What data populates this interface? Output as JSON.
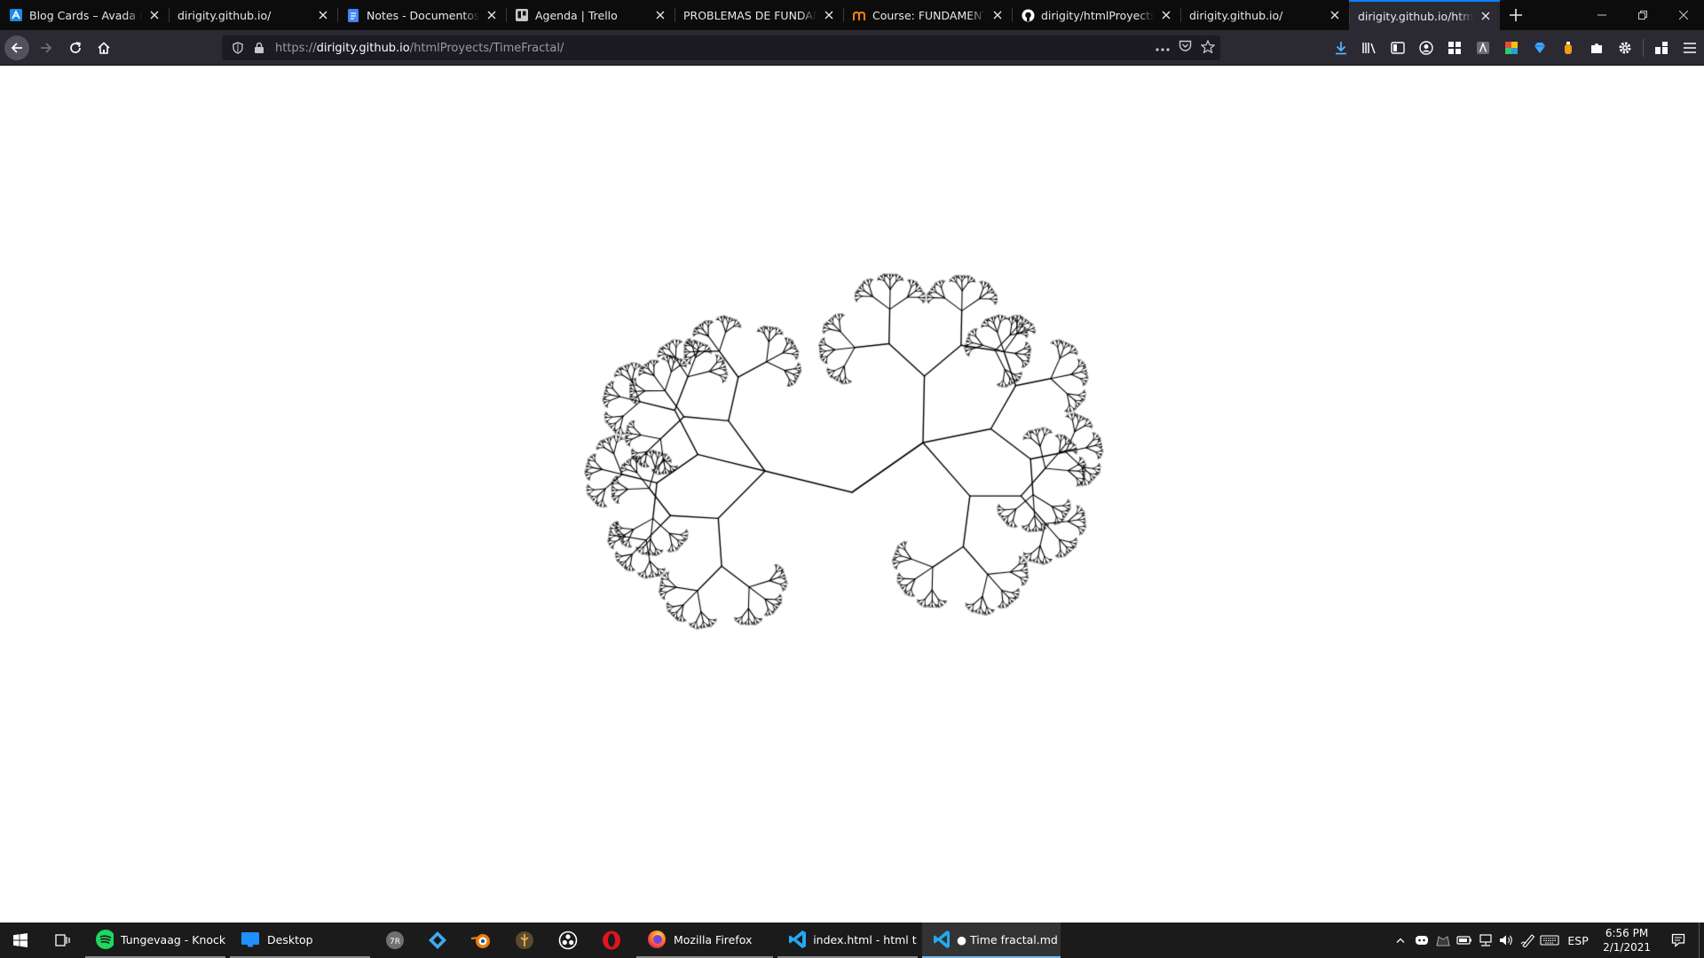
{
  "browser": {
    "tabs": [
      {
        "title": "Blog Cards – Avada Blog",
        "icon": "avada-icon",
        "color": "#1e88e5"
      },
      {
        "title": "dirigity.github.io/",
        "icon": "none"
      },
      {
        "title": "Notes - Documentos de Google",
        "icon": "google-docs-icon",
        "color": "#4285f4"
      },
      {
        "title": "Agenda | Trello",
        "icon": "trello-icon",
        "color": "#c7c7c7"
      },
      {
        "title": "PROBLEMAS DE FUNDAMENTOS",
        "icon": "none"
      },
      {
        "title": "Course: FUNDAMENTOS",
        "icon": "moodle-icon",
        "color": "#f98012"
      },
      {
        "title": "dirigity/htmlProyects",
        "icon": "github-icon",
        "color": "#ffffff"
      },
      {
        "title": "dirigity.github.io/",
        "icon": "none"
      },
      {
        "title": "dirigity.github.io/htmlProyects",
        "icon": "none",
        "active": true
      }
    ],
    "url": {
      "scheme": "https://",
      "host": "dirigity.github.io",
      "path": "/htmlProyects/TimeFractal/"
    },
    "accent": "#0a84ff"
  },
  "taskbar": {
    "apps": [
      {
        "label": "Tungevaag - Knock...",
        "icon": "spotify-icon"
      },
      {
        "label": "Desktop",
        "icon": "desktop-icon"
      },
      {
        "label": "Mozilla Firefox",
        "icon": "firefox-icon"
      },
      {
        "label": "index.html - html t...",
        "icon": "vscode-icon"
      },
      {
        "label": "● Time fractal.md -...",
        "icon": "vscode-icon"
      }
    ],
    "pinned": [
      "todoist-icon",
      "vortex-icon",
      "blender-icon",
      "app-icon",
      "obs-icon",
      "opera-icon"
    ],
    "tray": {
      "language": "ESP",
      "time": "6:56 PM",
      "date": "2/1/2021"
    }
  },
  "fractal": {
    "color": "#000000",
    "background": "#ffffff"
  }
}
